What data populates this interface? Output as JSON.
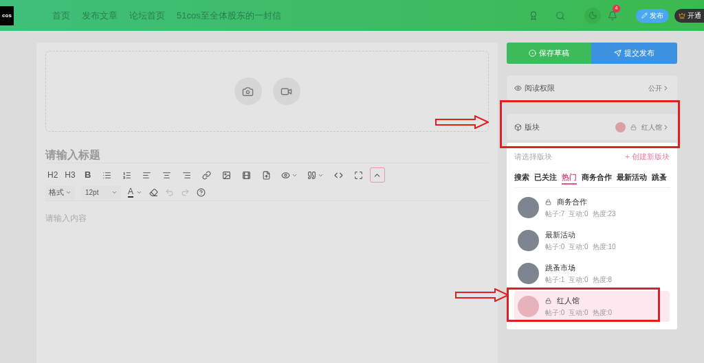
{
  "header": {
    "logo": "cos",
    "nav": [
      {
        "label": "首页"
      },
      {
        "label": "发布文章"
      },
      {
        "label": "论坛首页"
      },
      {
        "label": "51cos至全体股东的一封信"
      }
    ],
    "notification_count": "4",
    "publish_button": "发布",
    "vip_button": "开通"
  },
  "editor": {
    "title_placeholder": "请输入标题",
    "toolbar": [
      {
        "kind": "text",
        "label": "H2"
      },
      {
        "kind": "text",
        "label": "H3"
      },
      {
        "kind": "bold",
        "label": "B"
      },
      {
        "kind": "icon"
      },
      {
        "kind": "icon"
      },
      {
        "kind": "icon"
      },
      {
        "kind": "icon"
      },
      {
        "kind": "icon"
      },
      {
        "kind": "icon"
      },
      {
        "kind": "icon"
      },
      {
        "kind": "icon"
      },
      {
        "kind": "icon"
      },
      {
        "kind": "menu"
      },
      {
        "kind": "menu"
      },
      {
        "kind": "icon"
      },
      {
        "kind": "icon"
      },
      {
        "kind": "toggle",
        "active": true
      }
    ],
    "format_select": "格式",
    "size_select": "12pt",
    "color_letter": "A",
    "undo_disabled": true,
    "redo_disabled": true,
    "content_placeholder": "请输入内容"
  },
  "sidebar": {
    "save_button": "保存草稿",
    "submit_button": "提交发布",
    "read_permission": {
      "label": "阅读权限",
      "value": "公开"
    },
    "section": {
      "label": "版块",
      "value": "红人馆"
    },
    "picker": {
      "placeholder": "请选择版块",
      "create_link": "+ 创建新版块",
      "tabs": [
        {
          "label": "搜索",
          "selected": false
        },
        {
          "label": "已关注",
          "selected": false
        },
        {
          "label": "热门",
          "selected": true
        },
        {
          "label": "商务合作",
          "selected": false
        },
        {
          "label": "最新活动",
          "selected": false
        },
        {
          "label": "跳蚤",
          "selected": false
        }
      ],
      "items": [
        {
          "name": "商务合作",
          "locked": true,
          "selected": false,
          "stats": [
            "帖子:7",
            "互动:0",
            "热度:23"
          ]
        },
        {
          "name": "最新活动",
          "locked": false,
          "selected": false,
          "stats": [
            "帖子:0",
            "互动:0",
            "热度:10"
          ]
        },
        {
          "name": "跳蚤市场",
          "locked": false,
          "selected": false,
          "stats": [
            "帖子:1",
            "互动:0",
            "热度:8"
          ]
        },
        {
          "name": "红人馆",
          "locked": true,
          "selected": true,
          "stats": [
            "帖子:0",
            "互动:0",
            "热度:0"
          ]
        }
      ]
    }
  }
}
